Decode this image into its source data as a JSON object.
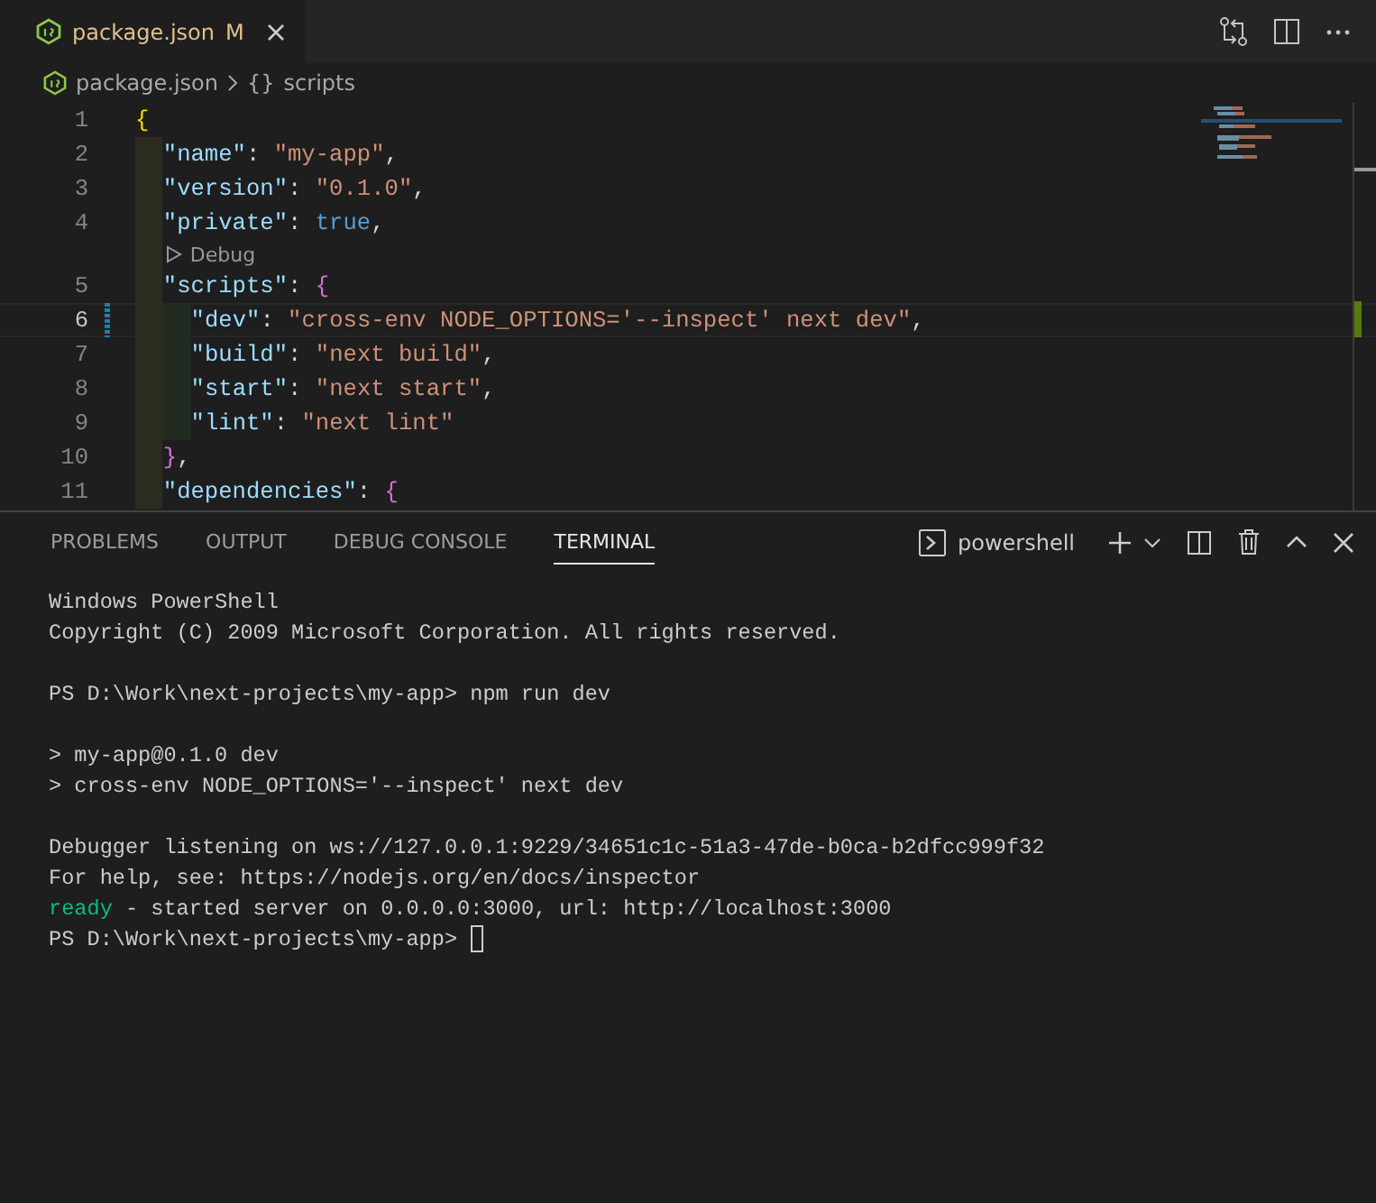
{
  "tabs": [
    {
      "label": "package.json",
      "badge": "M",
      "selected": true
    }
  ],
  "breadcrumb": {
    "file": "package.json",
    "symbol_glyph": "{}",
    "symbol": "scripts"
  },
  "editor": {
    "lines": [
      {
        "kind": "code",
        "number": "1",
        "current": false,
        "modified": false,
        "tokens": [
          {
            "kind": "b1",
            "text": "{"
          }
        ],
        "children": [
          {
            "kind": "code",
            "number": "2",
            "current": false,
            "modified": false,
            "tokens": [
              {
                "kind": "key",
                "text": "\"name\""
              },
              {
                "kind": "p",
                "text": ": "
              },
              {
                "kind": "str",
                "text": "\"my-app\""
              },
              {
                "kind": "p",
                "text": ","
              }
            ]
          },
          {
            "kind": "code",
            "number": "3",
            "current": false,
            "modified": false,
            "tokens": [
              {
                "kind": "key",
                "text": "\"version\""
              },
              {
                "kind": "p",
                "text": ": "
              },
              {
                "kind": "str",
                "text": "\"0.1.0\""
              },
              {
                "kind": "p",
                "text": ","
              }
            ]
          },
          {
            "kind": "code",
            "number": "4",
            "current": false,
            "modified": false,
            "tokens": [
              {
                "kind": "key",
                "text": "\"private\""
              },
              {
                "kind": "p",
                "text": ": "
              },
              {
                "kind": "bool",
                "text": "true"
              },
              {
                "kind": "p",
                "text": ","
              }
            ]
          },
          {
            "kind": "codelens",
            "text": "Debug"
          },
          {
            "kind": "code",
            "number": "5",
            "current": false,
            "modified": false,
            "tokens": [
              {
                "kind": "key",
                "text": "\"scripts\""
              },
              {
                "kind": "p",
                "text": ": "
              },
              {
                "kind": "b2",
                "text": "{"
              }
            ],
            "children": [
              {
                "kind": "code",
                "number": "6",
                "current": true,
                "modified": true,
                "tokens": [
                  {
                    "kind": "key",
                    "text": "\"dev\""
                  },
                  {
                    "kind": "p",
                    "text": ": "
                  },
                  {
                    "kind": "str",
                    "text": "\"cross-env NODE_OPTIONS='--inspect' next dev\""
                  },
                  {
                    "kind": "p",
                    "text": ","
                  }
                ]
              },
              {
                "kind": "code",
                "number": "7",
                "current": false,
                "modified": false,
                "tokens": [
                  {
                    "kind": "key",
                    "text": "\"build\""
                  },
                  {
                    "kind": "p",
                    "text": ": "
                  },
                  {
                    "kind": "str",
                    "text": "\"next build\""
                  },
                  {
                    "kind": "p",
                    "text": ","
                  }
                ]
              },
              {
                "kind": "code",
                "number": "8",
                "current": false,
                "modified": false,
                "tokens": [
                  {
                    "kind": "key",
                    "text": "\"start\""
                  },
                  {
                    "kind": "p",
                    "text": ": "
                  },
                  {
                    "kind": "str",
                    "text": "\"next start\""
                  },
                  {
                    "kind": "p",
                    "text": ","
                  }
                ]
              },
              {
                "kind": "code",
                "number": "9",
                "current": false,
                "modified": false,
                "tokens": [
                  {
                    "kind": "key",
                    "text": "\"lint\""
                  },
                  {
                    "kind": "p",
                    "text": ": "
                  },
                  {
                    "kind": "str",
                    "text": "\"next lint\""
                  }
                ]
              }
            ]
          },
          {
            "kind": "code",
            "number": "10",
            "current": false,
            "modified": false,
            "tokens": [
              {
                "kind": "b2",
                "text": "}"
              },
              {
                "kind": "p",
                "text": ","
              }
            ]
          },
          {
            "kind": "code",
            "number": "11",
            "current": false,
            "modified": false,
            "tokens": [
              {
                "kind": "key",
                "text": "\"dependencies\""
              },
              {
                "kind": "p",
                "text": ": "
              },
              {
                "kind": "b2",
                "text": "{"
              }
            ]
          }
        ]
      }
    ]
  },
  "panel": {
    "tabs": [
      {
        "label": "PROBLEMS",
        "selected": false
      },
      {
        "label": "OUTPUT",
        "selected": false
      },
      {
        "label": "DEBUG CONSOLE",
        "selected": false
      },
      {
        "label": "TERMINAL",
        "selected": true
      }
    ],
    "shell": "powershell"
  },
  "terminal": {
    "lines": [
      {
        "kind": "text",
        "cursor": false,
        "tokens": [
          {
            "kind": "plain",
            "text": "Windows PowerShell"
          }
        ]
      },
      {
        "kind": "text",
        "cursor": false,
        "tokens": [
          {
            "kind": "plain",
            "text": "Copyright (C) 2009 Microsoft Corporation. All rights reserved."
          }
        ]
      },
      {
        "kind": "blank"
      },
      {
        "kind": "text",
        "cursor": false,
        "tokens": [
          {
            "kind": "plain",
            "text": "PS D:\\Work\\next-projects\\my-app> npm run dev"
          }
        ]
      },
      {
        "kind": "blank"
      },
      {
        "kind": "text",
        "cursor": false,
        "tokens": [
          {
            "kind": "plain",
            "text": "> my-app@0.1.0 dev"
          }
        ]
      },
      {
        "kind": "text",
        "cursor": false,
        "tokens": [
          {
            "kind": "plain",
            "text": "> cross-env NODE_OPTIONS='--inspect' next dev"
          }
        ]
      },
      {
        "kind": "blank"
      },
      {
        "kind": "text",
        "cursor": false,
        "tokens": [
          {
            "kind": "plain",
            "text": "Debugger listening on ws://127.0.0.1:9229/34651c1c-51a3-47de-b0ca-b2dfcc999f32"
          }
        ]
      },
      {
        "kind": "text",
        "cursor": false,
        "tokens": [
          {
            "kind": "plain",
            "text": "For help, see: https://nodejs.org/en/docs/inspector"
          }
        ]
      },
      {
        "kind": "text",
        "cursor": false,
        "tokens": [
          {
            "kind": "green",
            "text": "ready"
          },
          {
            "kind": "plain",
            "text": " - started server on 0.0.0.0:3000, url: http://localhost:3000"
          }
        ]
      },
      {
        "kind": "text",
        "cursor": true,
        "tokens": [
          {
            "kind": "plain",
            "text": "PS D:\\Work\\next-projects\\my-app> "
          }
        ]
      }
    ]
  }
}
